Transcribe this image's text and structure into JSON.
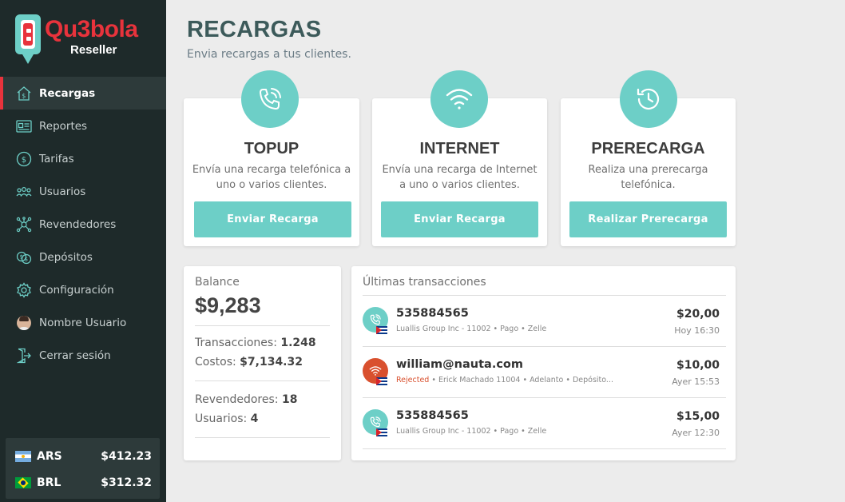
{
  "brand": {
    "name": "Qu3bola",
    "subtitle": "Reseller"
  },
  "sidebar": {
    "items": [
      {
        "label": "Recargas",
        "icon": "recharge-icon",
        "active": true
      },
      {
        "label": "Reportes",
        "icon": "reports-icon"
      },
      {
        "label": "Tarifas",
        "icon": "rates-icon"
      },
      {
        "label": "Usuarios",
        "icon": "users-icon"
      },
      {
        "label": "Revendedores",
        "icon": "resellers-icon"
      },
      {
        "label": "Depósitos",
        "icon": "deposits-icon"
      },
      {
        "label": "Configuración",
        "icon": "settings-icon"
      },
      {
        "label": "Nombre Usuario",
        "icon": "avatar"
      },
      {
        "label": "Cerrar sesión",
        "icon": "logout-icon"
      }
    ],
    "currencies": [
      {
        "code": "ARS",
        "value": "$412.23",
        "flag": "argentina-flag"
      },
      {
        "code": "BRL",
        "value": "$312.32",
        "flag": "brazil-flag"
      }
    ]
  },
  "header": {
    "title": "RECARGAS",
    "subtitle": "Envia recargas a tus clientes."
  },
  "actions": [
    {
      "title": "TOPUP",
      "description": "Envía una recarga telefónica a uno o varios clientes.",
      "button": "Enviar Recarga",
      "icon": "phone-call-icon"
    },
    {
      "title": "INTERNET",
      "description": "Envía una recarga de Internet a uno o varios clientes.",
      "button": "Enviar Recarga",
      "icon": "wifi-icon"
    },
    {
      "title": "PRERECARGA",
      "description": "Realiza una prerecarga telefónica.",
      "button": "Realizar Prerecarga",
      "icon": "history-icon"
    }
  ],
  "balance": {
    "label": "Balance",
    "value": "$9,283",
    "transactions_label": "Transacciones:",
    "transactions_value": "1.248",
    "costs_label": "Costos:",
    "costs_value": "$7,134.32",
    "resellers_label": "Revendedores:",
    "resellers_value": "18",
    "users_label": "Usuarios:",
    "users_value": "4"
  },
  "transactions": {
    "title": "Últimas transacciones",
    "rows": [
      {
        "name": "535884565",
        "status": "",
        "meta": "Luallis Group Inc - 11002 • Pago • Zelle",
        "amount": "$20,00",
        "time": "Hoy 16:30",
        "type": "phone"
      },
      {
        "name": "william@nauta.com",
        "status": "Rejected",
        "meta": " • Erick Machado 11004 • Adelanto • Depósito...",
        "amount": "$10,00",
        "time": "Ayer 15:53",
        "type": "internet"
      },
      {
        "name": "535884565",
        "status": "",
        "meta": "Luallis Group Inc - 11002 • Pago • Zelle",
        "amount": "$15,00",
        "time": "Ayer 12:30",
        "type": "phone"
      }
    ]
  },
  "colors": {
    "accent": "#6dcfc7",
    "brand_red": "#e8333c",
    "sidebar": "#1e2a2a",
    "rejected": "#d9502e"
  }
}
